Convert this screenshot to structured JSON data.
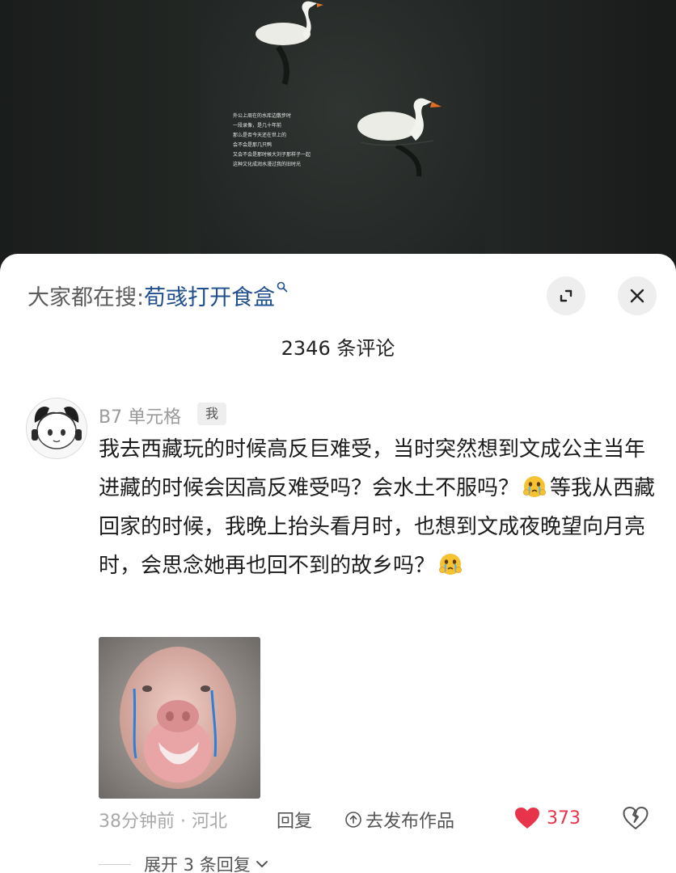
{
  "video": {
    "overlay_caption_lines": [
      "外公上周在的水库边散步时",
      "一段录像，是几十年前",
      "那么是否今天还在世上的",
      "会不会是那几只鸭",
      "又会不会是那时候大刘子那样子一起",
      "这种文化成润水漫过我的旧时光"
    ]
  },
  "search": {
    "prefix": "大家都在搜:",
    "term": "荀彧打开食盒"
  },
  "comments_header": {
    "count_label": "2346 条评论"
  },
  "comment": {
    "username": "B7 单元格",
    "badge": "我",
    "text_part1": "我去西藏玩的时候高反巨难受，当时突然想到文成公主当年进藏的时候会因高反难受吗？会水土不服吗？",
    "text_part2": "等我从西藏回家的时候，我晚上抬头看月时，也想到文成夜晚望向月亮时，会思念她再也回不到的故乡吗？",
    "time_location": "38分钟前 · 河北",
    "reply_label": "回复",
    "publish_label": "去发布作品",
    "like_count": "373",
    "expand_replies_label": "展开 3 条回复"
  },
  "icons": {
    "search": "search-icon",
    "expand": "expand-icon",
    "close": "close-icon",
    "emoji": "crying-face-emoji",
    "publish": "arrow-up-circle-icon",
    "like": "heart-icon",
    "dislike": "broken-heart-icon",
    "chevron": "chevron-down-icon"
  },
  "colors": {
    "search_term": "#1f4f8c",
    "like": "#e8344a",
    "muted": "#a8a8a8"
  }
}
